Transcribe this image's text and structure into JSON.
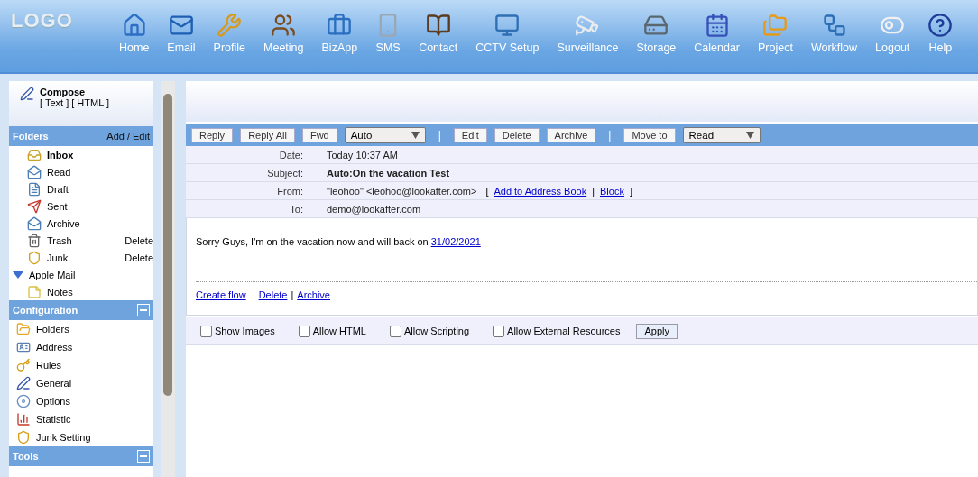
{
  "logo": "LOGO",
  "nav": [
    "Home",
    "Email",
    "Profile",
    "Meeting",
    "BizApp",
    "SMS",
    "Contact",
    "CCTV Setup",
    "Surveillance",
    "Storage",
    "Calendar",
    "Project",
    "Workflow",
    "Logout",
    "Help"
  ],
  "compose": {
    "title": "Compose",
    "formats": "[ Text ] [ HTML ]"
  },
  "folders": {
    "title": "Folders",
    "action": "Add / Edit",
    "items": [
      {
        "label": "Inbox",
        "selected": true
      },
      {
        "label": "Read",
        "selected": false
      },
      {
        "label": "Draft",
        "selected": false
      },
      {
        "label": "Sent",
        "selected": false
      },
      {
        "label": "Archive",
        "selected": false
      },
      {
        "label": "Trash",
        "selected": false,
        "action": "Delete"
      },
      {
        "label": "Junk",
        "selected": false,
        "action": "Delete"
      },
      {
        "label": "Apple Mail",
        "selected": false,
        "expanded": true,
        "children": [
          {
            "label": "Notes",
            "selected": false
          }
        ]
      }
    ]
  },
  "sections": [
    {
      "title": "Configuration",
      "expanded": true,
      "items": [
        "Folders",
        "Address",
        "Rules",
        "General",
        "Options",
        "Statistic",
        "Junk Setting"
      ]
    },
    {
      "title": "Tools",
      "expanded": true
    }
  ],
  "toolbar": [
    {
      "kind": "button",
      "label": "Reply"
    },
    {
      "kind": "button",
      "label": "Reply All"
    },
    {
      "kind": "button",
      "label": "Fwd"
    },
    {
      "kind": "select",
      "label": "Auto"
    },
    {
      "kind": "separator",
      "label": "|"
    },
    {
      "kind": "button",
      "label": "Edit"
    },
    {
      "kind": "button",
      "label": "Delete"
    },
    {
      "kind": "button",
      "label": "Archive"
    },
    {
      "kind": "separator",
      "label": "|"
    },
    {
      "kind": "button",
      "label": "Move to"
    },
    {
      "kind": "select",
      "label": "Read"
    }
  ],
  "headers": [
    {
      "label": "Date:",
      "value": "Today 10:37 AM"
    },
    {
      "label": "Subject:",
      "value": "Auto:On the vacation Test",
      "bold": true
    },
    {
      "label": "From:",
      "value": "\"leohoo\" <leohoo@lookafter.com>",
      "links": [
        {
          "kind": "text",
          "label": "["
        },
        {
          "kind": "link",
          "label": "Add to Address Book"
        },
        {
          "kind": "text",
          "label": "|"
        },
        {
          "kind": "link",
          "label": "Block"
        },
        {
          "kind": "text",
          "label": "]"
        }
      ]
    },
    {
      "label": "To:",
      "value": "demo@lookafter.com"
    }
  ],
  "body": {
    "text": "Sorry Guys, I'm on the vacation now and will back on",
    "link": "31/02/2021"
  },
  "actions": [
    {
      "kind": "link",
      "label": "Create flow"
    },
    {
      "kind": "link",
      "label": "Delete"
    },
    {
      "kind": "text",
      "label": "|"
    },
    {
      "kind": "link",
      "label": "Archive"
    }
  ],
  "options": [
    {
      "label": "Show Images",
      "checked": false
    },
    {
      "label": "Allow HTML",
      "checked": false
    },
    {
      "label": "Allow Scripting",
      "checked": false
    },
    {
      "label": "Allow External Resources",
      "checked": false
    }
  ],
  "apply": "Apply"
}
